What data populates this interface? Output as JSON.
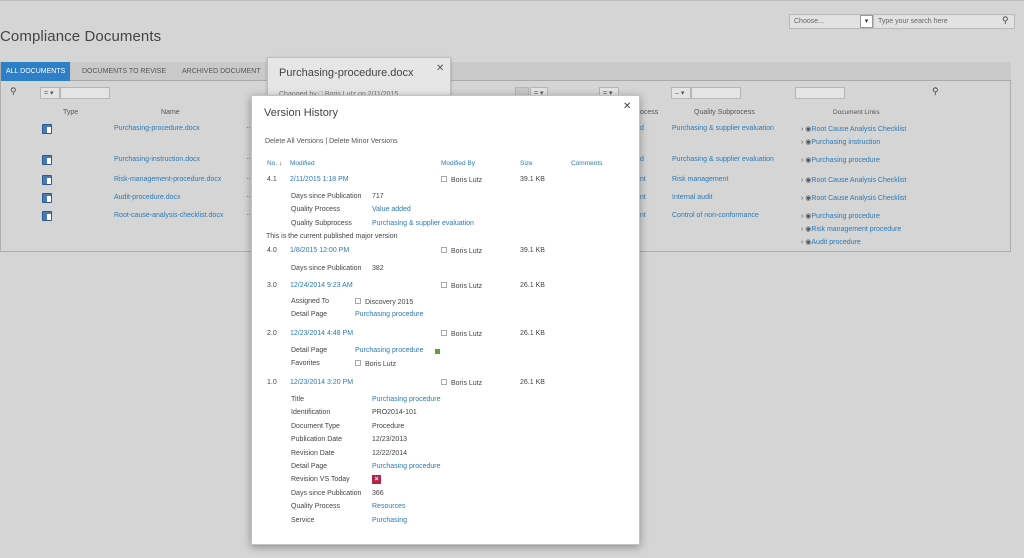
{
  "header": {
    "scope_text": "Choose...",
    "search_placeholder": "Type your search here",
    "page_title": "Compliance Documents"
  },
  "tabs": [
    {
      "label": "ALL DOCUMENTS"
    },
    {
      "label": "DOCUMENTS TO REVISE"
    },
    {
      "label": "ARCHIVED DOCUMENT"
    }
  ],
  "filters": {
    "eq1": "= ▾",
    "date_op": "= ▾",
    "dash_op": "– ▾",
    "eq2": "= ▾",
    "eq3": "= ▾"
  },
  "columns": {
    "type": "Type",
    "name": "Name",
    "process": "ocess",
    "quality_subprocess": "Quality Subprocess",
    "document_links": "Document Links"
  },
  "rows": [
    {
      "name": "Purchasing-procedure.docx",
      "proc": "d",
      "sub": "Purchasing & supplier evaluation",
      "links": [
        "Root Cause Analysis Checklist",
        "Purchasing instruction"
      ]
    },
    {
      "name": "Purchasing-instruction.docx",
      "proc": "d",
      "sub": "Purchasing & supplier evaluation",
      "links": [
        "Purchasing procedure"
      ]
    },
    {
      "name": "Risk-management-procedure.docx",
      "proc": "nt",
      "sub": "Risk management",
      "links": [
        "Root Cause Analysis Checklist"
      ]
    },
    {
      "name": "Audit-procedure.docx",
      "proc": "nt",
      "sub": "Internal audit",
      "links": [
        "Root Cause Analysis Checklist"
      ]
    },
    {
      "name": "Root-cause-analysis-checklist.docx",
      "proc": "nt",
      "sub": "Control of non-conformance",
      "links": [
        "Purchasing procedure",
        "Risk management procedure",
        "Audit procedure"
      ]
    }
  ],
  "peek": {
    "title": "Purchasing-procedure.docx",
    "subtitle": "Changed by  □  Boris Lutz on 2/11/2015"
  },
  "modal": {
    "title": "Version History",
    "delete_all": "Delete All Versions",
    "separator": "|",
    "delete_minor": "Delete Minor Versions",
    "headers": {
      "no": "No.",
      "modified": "Modified",
      "modified_by": "Modified By",
      "size": "Size",
      "comments": "Comments"
    },
    "current_note": "This is the current published major version",
    "versions": [
      {
        "no": "4.1",
        "date": "2/11/2015 1:18 PM",
        "by": "Boris Lutz",
        "size": "39.1 KB",
        "props": [
          {
            "label": "Days since Publication",
            "value": "717"
          },
          {
            "label": "Quality Process",
            "value": "Value added"
          },
          {
            "label": "Quality Subprocess",
            "value": "Purchasing & supplier evaluation"
          }
        ]
      },
      {
        "no": "4.0",
        "date": "1/8/2015 12:00 PM",
        "by": "Boris Lutz",
        "size": "39.1 KB",
        "props": [
          {
            "label": "Days since Publication",
            "value": "382"
          }
        ]
      },
      {
        "no": "3.0",
        "date": "12/24/2014 9:23 AM",
        "by": "Boris Lutz",
        "size": "26.1 KB",
        "props": [
          {
            "label": "Assigned To",
            "value": "Discovery 2015"
          },
          {
            "label": "Detail Page",
            "value": "Purchasing procedure"
          }
        ]
      },
      {
        "no": "2.0",
        "date": "12/23/2014 4:48 PM",
        "by": "Boris Lutz",
        "size": "26.1 KB",
        "props": [
          {
            "label": "Detail Page",
            "value": "Purchasing procedure"
          },
          {
            "label": "Favorites",
            "value": "Boris Lutz"
          }
        ]
      },
      {
        "no": "1.0",
        "date": "12/23/2014 3:20 PM",
        "by": "Boris Lutz",
        "size": "26.1 KB",
        "props": [
          {
            "label": "Title",
            "value": "Purchasing procedure"
          },
          {
            "label": "Identification",
            "value": "PRO2014-101"
          },
          {
            "label": "Document Type",
            "value": "Procedure"
          },
          {
            "label": "Publication Date",
            "value": "12/23/2013"
          },
          {
            "label": "Revision Date",
            "value": "12/22/2014"
          },
          {
            "label": "Detail Page",
            "value": "Purchasing procedure"
          },
          {
            "label": "Revision VS Today",
            "value": ""
          },
          {
            "label": "Days since Publication",
            "value": "366"
          },
          {
            "label": "Quality Process",
            "value": "Resources"
          },
          {
            "label": "Service",
            "value": "Purchasing"
          }
        ]
      }
    ]
  },
  "icons": {
    "search": "search-icon",
    "close": "close-icon",
    "document": "word-document-icon",
    "eye": "eye-icon"
  }
}
